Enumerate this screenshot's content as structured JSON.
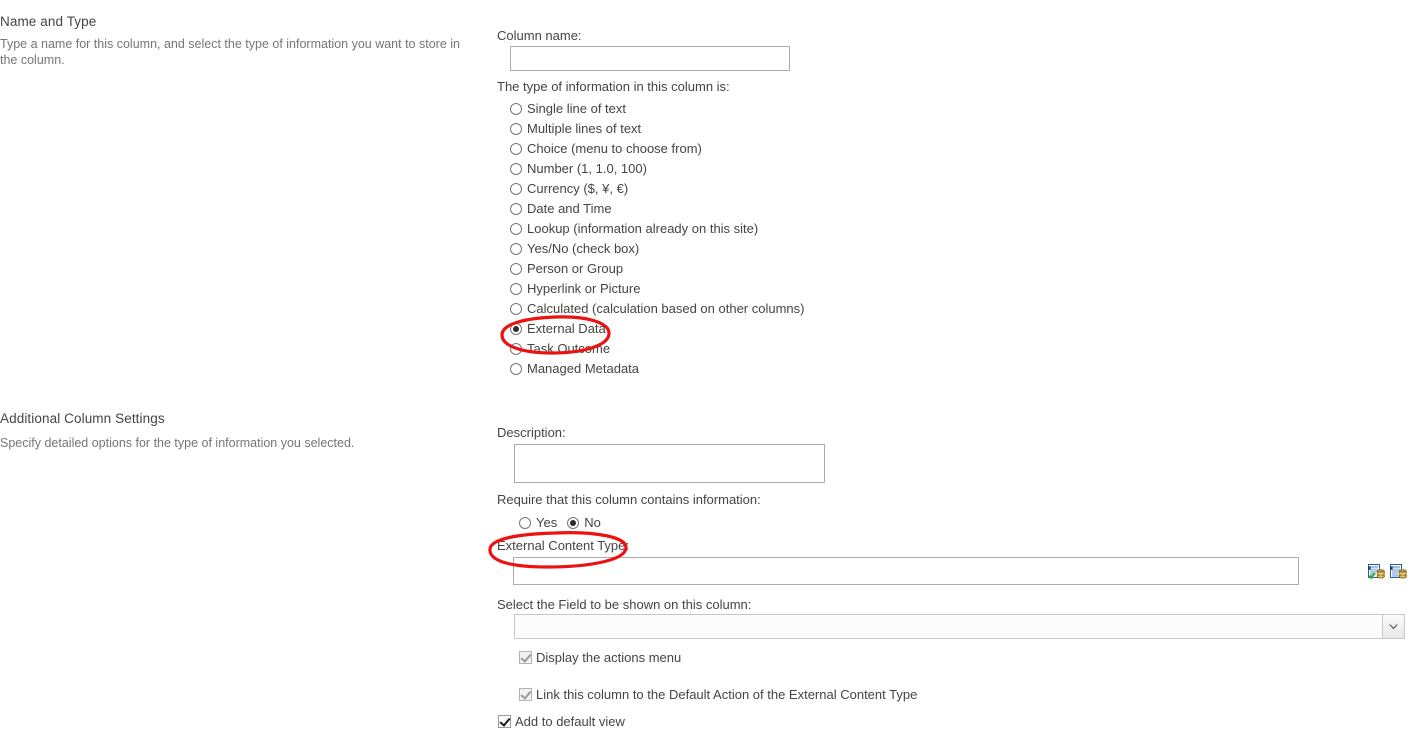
{
  "sections": {
    "name_and_type": {
      "title": "Name and Type",
      "description": "Type a name for this column, and select the type of information you want to store in the column."
    },
    "additional_column_settings": {
      "title": "Additional Column Settings",
      "description": "Specify detailed options for the type of information you selected."
    }
  },
  "form": {
    "column_name_label": "Column name:",
    "column_name_value": "",
    "column_name_placeholder": "",
    "type_label": "The type of information in this column is:",
    "type_options": [
      {
        "label": "Single line of text",
        "selected": false
      },
      {
        "label": "Multiple lines of text",
        "selected": false
      },
      {
        "label": "Choice (menu to choose from)",
        "selected": false
      },
      {
        "label": "Number (1, 1.0, 100)",
        "selected": false
      },
      {
        "label": "Currency ($, ¥, €)",
        "selected": false
      },
      {
        "label": "Date and Time",
        "selected": false
      },
      {
        "label": "Lookup (information already on this site)",
        "selected": false
      },
      {
        "label": "Yes/No (check box)",
        "selected": false
      },
      {
        "label": "Person or Group",
        "selected": false
      },
      {
        "label": "Hyperlink or Picture",
        "selected": false
      },
      {
        "label": "Calculated (calculation based on other columns)",
        "selected": false
      },
      {
        "label": "External Data",
        "selected": true
      },
      {
        "label": "Task Outcome",
        "selected": false
      },
      {
        "label": "Managed Metadata",
        "selected": false
      }
    ],
    "description_label": "Description:",
    "description_value": "",
    "require_label": "Require that this column contains information:",
    "require_options": [
      {
        "label": "Yes",
        "selected": false
      },
      {
        "label": "No",
        "selected": true
      }
    ],
    "external_content_type_label": "External Content Type:",
    "external_content_type_value": "",
    "external_content_type_placeholder": "",
    "picker_icons": [
      {
        "name": "check-external-content-type-icon",
        "title": ""
      },
      {
        "name": "browse-external-content-type-icon",
        "title": ""
      }
    ],
    "select_field_label": "Select the Field to be shown on this column:",
    "select_field_value": "",
    "checkboxes": [
      {
        "label": "Display the actions menu",
        "checked": true,
        "disabled": true
      },
      {
        "label": "Link this column to the Default Action of the External Content Type",
        "checked": true,
        "disabled": true
      },
      {
        "label": "Add to default view",
        "checked": true,
        "disabled": false
      }
    ]
  },
  "annotations": {
    "color": "#ee1111",
    "shapes": [
      {
        "name": "external-data-highlight",
        "target": "External Data"
      },
      {
        "name": "external-content-type-highlight",
        "target": "External Content Type:"
      }
    ]
  }
}
